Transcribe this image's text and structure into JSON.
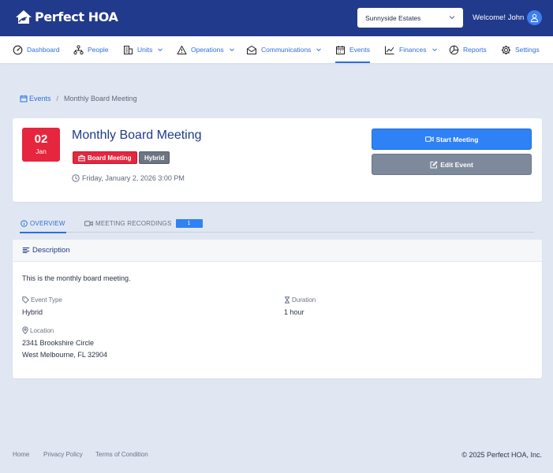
{
  "header": {
    "brand": "Perfect HOA",
    "community": "Sunnyside Estates",
    "welcome": "Welcome! John"
  },
  "nav": {
    "items": [
      {
        "label": "Dashboard",
        "icon": "dashboard-gauge-icon",
        "dropdown": false
      },
      {
        "label": "People",
        "icon": "people-network-icon",
        "dropdown": false
      },
      {
        "label": "Units",
        "icon": "building-icon",
        "dropdown": true
      },
      {
        "label": "Operations",
        "icon": "warning-triangle-icon",
        "dropdown": true
      },
      {
        "label": "Communications",
        "icon": "envelope-icon",
        "dropdown": true
      },
      {
        "label": "Events",
        "icon": "calendar-icon",
        "dropdown": false,
        "active": true
      },
      {
        "label": "Finances",
        "icon": "line-chart-icon",
        "dropdown": true
      },
      {
        "label": "Reports",
        "icon": "pie-chart-icon",
        "dropdown": false
      },
      {
        "label": "Settings",
        "icon": "gear-icon",
        "dropdown": false
      }
    ]
  },
  "breadcrumb": {
    "parent": "Events",
    "current": "Monthly Board Meeting"
  },
  "event": {
    "day": "02",
    "month": "Jan",
    "title": "Monthly Board Meeting",
    "type_badge": "Board Meeting",
    "mode_badge": "Hybrid",
    "datetime": "Friday, January 2, 2026 3:00 PM",
    "start_label": "Start Meeting",
    "edit_label": "Edit Event"
  },
  "tabs": {
    "overview": "OVERVIEW",
    "recordings": "MEETING RECORDINGS",
    "recordings_count": "1"
  },
  "description": {
    "heading": "Description",
    "text": "This is the monthly board meeting.",
    "event_type_label": "Event Type",
    "event_type": "Hybrid",
    "duration_label": "Duration",
    "duration": "1 hour",
    "location_label": "Location",
    "location_line1": "2341 Brookshire Circle",
    "location_line2": "West Melbourne, FL 32904"
  },
  "footer": {
    "home": "Home",
    "privacy": "Privacy Policy",
    "terms": "Terms of Condition",
    "copyright": "© 2025 Perfect HOA, Inc."
  },
  "colors": {
    "header_bg": "#213a8c",
    "accent": "#2c6fdc",
    "date_badge": "#e6263e",
    "start_button": "#2f82f5",
    "edit_button": "#7e8a9c",
    "page_bg": "#e1e7f2"
  }
}
